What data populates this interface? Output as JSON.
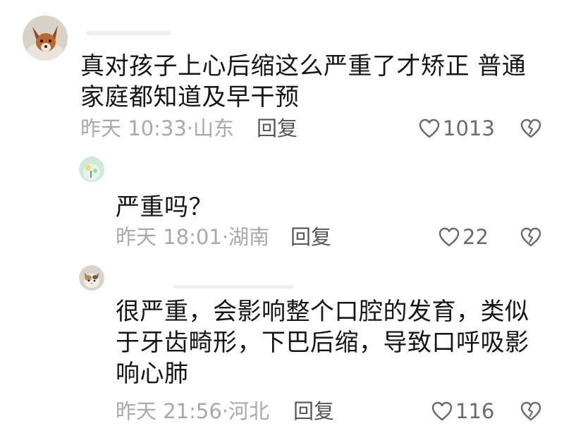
{
  "comments": [
    {
      "avatar": "fox-avatar",
      "text": "真对孩子上心后缩这么严重了才矫正 普通\n家庭都知道及早干预",
      "time": "昨天 10:33",
      "location": "山东",
      "reply_label": "回复",
      "likes": "1013"
    },
    {
      "avatar": "flower-avatar",
      "text": "严重吗？",
      "time": "昨天 18:01",
      "location": "湖南",
      "reply_label": "回复",
      "likes": "22"
    },
    {
      "avatar": "cat-avatar",
      "text": "很严重，会影响整个口腔的发育，类似\n于牙齿畸形，下巴后缩，导致口呼吸影\n响心肺",
      "time": "昨天 21:56",
      "location": "河北",
      "reply_label": "回复",
      "likes": "116"
    }
  ],
  "meta_separator": "·",
  "colors": {
    "text": "#161616",
    "meta": "#a9a9a9",
    "reply": "#555555",
    "icon": "#6b6b6b"
  },
  "icons": {
    "like": "heart-outline-icon",
    "dislike": "broken-heart-icon"
  }
}
